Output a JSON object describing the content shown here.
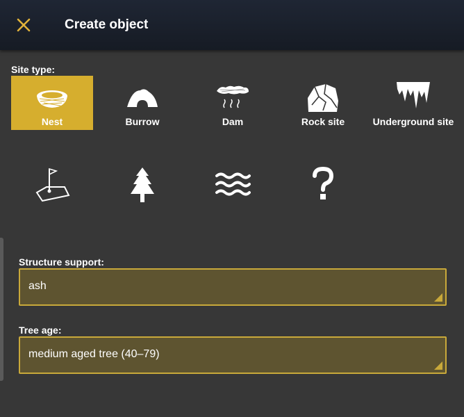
{
  "colors": {
    "background": "#373737",
    "accent": "#d6ae2e",
    "field_bg": "#5e5430",
    "field_border": "#c9a93a"
  },
  "header": {
    "title": "Create object",
    "close_icon": "close-icon"
  },
  "site_type": {
    "label": "Site type:",
    "selected": "Nest",
    "options": [
      {
        "label": "Nest",
        "icon": "nest-icon"
      },
      {
        "label": "Burrow",
        "icon": "burrow-icon"
      },
      {
        "label": "Dam",
        "icon": "dam-icon"
      },
      {
        "label": "Rock site",
        "icon": "rock-icon"
      },
      {
        "label": "Underground site",
        "icon": "underground-icon"
      }
    ],
    "icon_options": [
      "site-flag-icon",
      "tree-icon",
      "water-waves-icon",
      "question-icon"
    ]
  },
  "fields": {
    "structure_support": {
      "label": "Structure support:",
      "value": "ash"
    },
    "tree_age": {
      "label": "Tree age:",
      "value": "medium aged tree (40–79)"
    }
  }
}
